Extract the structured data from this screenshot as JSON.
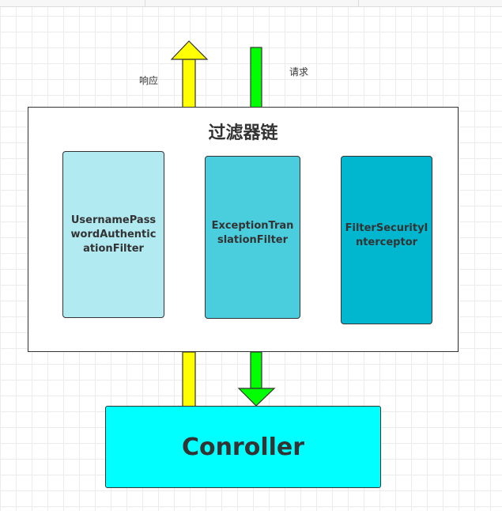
{
  "diagram": {
    "chain": {
      "title": "过滤器链",
      "filters": [
        {
          "label": "UsernamePasswordAuthenticationFilter",
          "fill": "#b1eaf1"
        },
        {
          "label": "ExceptionTranslationFilter",
          "fill": "#4acddd"
        },
        {
          "label": "FilterSecurityInterceptor",
          "fill": "#00b7cf"
        }
      ]
    },
    "controller": {
      "label": "Conroller",
      "fill": "#00ffff"
    },
    "arrows": {
      "response": {
        "label": "响应",
        "color": "#ffff00"
      },
      "request": {
        "label": "请求",
        "color": "#00ff00"
      }
    },
    "stroke_color": "#333333"
  }
}
